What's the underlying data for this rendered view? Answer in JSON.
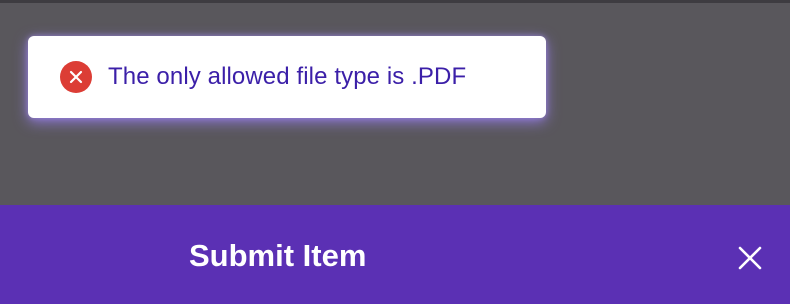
{
  "toast": {
    "icon": "error-x-circle-icon",
    "message": "The only allowed file type is .PDF",
    "icon_color": "#dc3d35",
    "text_color": "#3b1fa8"
  },
  "footer": {
    "title": "Submit Item",
    "close_icon": "close-icon",
    "background_color": "#5b30b4"
  },
  "overlay": {
    "background_color": "#59575c"
  }
}
